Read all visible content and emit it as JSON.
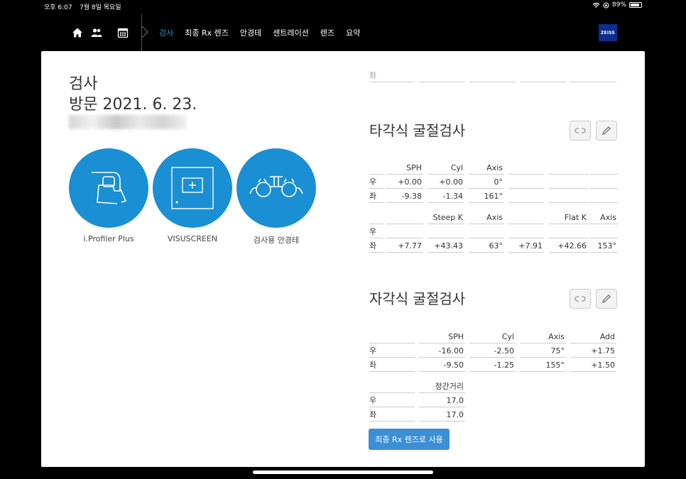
{
  "status": {
    "time": "오후 6:07",
    "date": "7월 8일 목요일",
    "battery": "89%",
    "battery_level": 0.89
  },
  "nav": {
    "tabs": [
      {
        "label": "검사",
        "active": true
      },
      {
        "label": "최종 Rx 렌즈",
        "active": false
      },
      {
        "label": "안경테",
        "active": false
      },
      {
        "label": "센트레이션",
        "active": false
      },
      {
        "label": "렌즈",
        "active": false
      },
      {
        "label": "요약",
        "active": false
      }
    ],
    "logo": "ZEISS"
  },
  "page": {
    "title": "검사",
    "visit": "방문 2021. 6. 23."
  },
  "devices": [
    {
      "label": "i.Profiler Plus",
      "icon": "iprofiler-icon"
    },
    {
      "label": "VISUSCREEN",
      "icon": "visuscreen-icon"
    },
    {
      "label": "검사용 안경테",
      "icon": "trial-frame-icon"
    }
  ],
  "top_row": {
    "label": "좌"
  },
  "objective": {
    "title": "타각식 굴절검사",
    "rx_headers": [
      "SPH",
      "Cyl",
      "Axis",
      "",
      "",
      ""
    ],
    "rx_rows": [
      {
        "eye": "우",
        "cells": [
          "+0.00",
          "+0.00",
          "0°",
          "",
          "",
          ""
        ]
      },
      {
        "eye": "좌",
        "cells": [
          "-9.38",
          "-1.34",
          "161°",
          "",
          "",
          ""
        ]
      }
    ],
    "k_headers": [
      "",
      "Steep K",
      "Axis",
      "",
      "Flat K",
      "Axis"
    ],
    "k_rows": [
      {
        "eye": "우",
        "cells": [
          "",
          "",
          "",
          "",
          "",
          ""
        ]
      },
      {
        "eye": "좌",
        "cells": [
          "+7.77",
          "+43.43",
          "63°",
          "+7.91",
          "+42.66",
          "153°"
        ]
      }
    ]
  },
  "subjective": {
    "title": "자각식 굴절검사",
    "headers": [
      "SPH",
      "Cyl",
      "Axis",
      "Add"
    ],
    "rows": [
      {
        "eye": "우",
        "cells": [
          "-16.00",
          "-2.50",
          "75°",
          "+1.75"
        ]
      },
      {
        "eye": "좌",
        "cells": [
          "-9.50",
          "-1.25",
          "155°",
          "+1.50"
        ]
      }
    ],
    "vd_header": "정간거리",
    "vd_rows": [
      {
        "eye": "우",
        "value": "17.0"
      },
      {
        "eye": "좌",
        "value": "17.0"
      }
    ]
  },
  "apply_button": "최종 Rx 렌즈로 사용"
}
